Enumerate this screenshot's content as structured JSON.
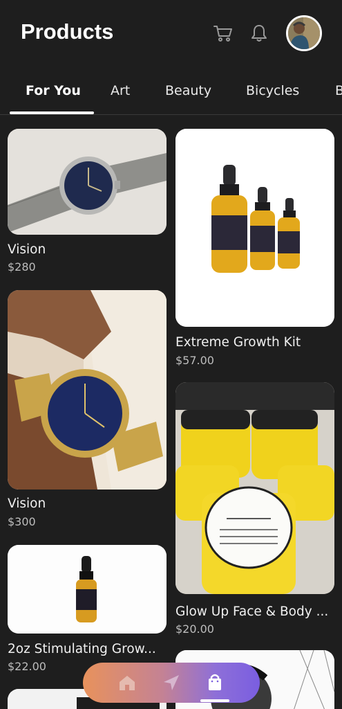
{
  "header": {
    "title": "Products",
    "cart_icon": "cart-icon",
    "bell_icon": "bell-icon",
    "avatar": "avatar"
  },
  "tabs": [
    {
      "label": "For You",
      "active": true
    },
    {
      "label": "Art",
      "active": false
    },
    {
      "label": "Beauty",
      "active": false
    },
    {
      "label": "Bicycles",
      "active": false
    },
    {
      "label": "B",
      "active": false
    }
  ],
  "products": [
    {
      "title": "Vision",
      "price": "$280"
    },
    {
      "title": "Extreme Growth Kit",
      "price": "$57.00"
    },
    {
      "title": "Vision",
      "price": "$300"
    },
    {
      "title": "Glow Up Face & Body ...",
      "price": "$20.00"
    },
    {
      "title": "2oz Stimulating Grow...",
      "price": "$22.00"
    }
  ],
  "bottom_nav": {
    "items": [
      "home-icon",
      "send-icon",
      "shopping-bag-icon"
    ],
    "active": "shopping-bag-icon",
    "gradient": [
      "#e8925c",
      "#7a5ee0"
    ]
  },
  "colors": {
    "background": "#1e1e1e",
    "text": "#ffffff",
    "price": "#bdbdbd"
  }
}
